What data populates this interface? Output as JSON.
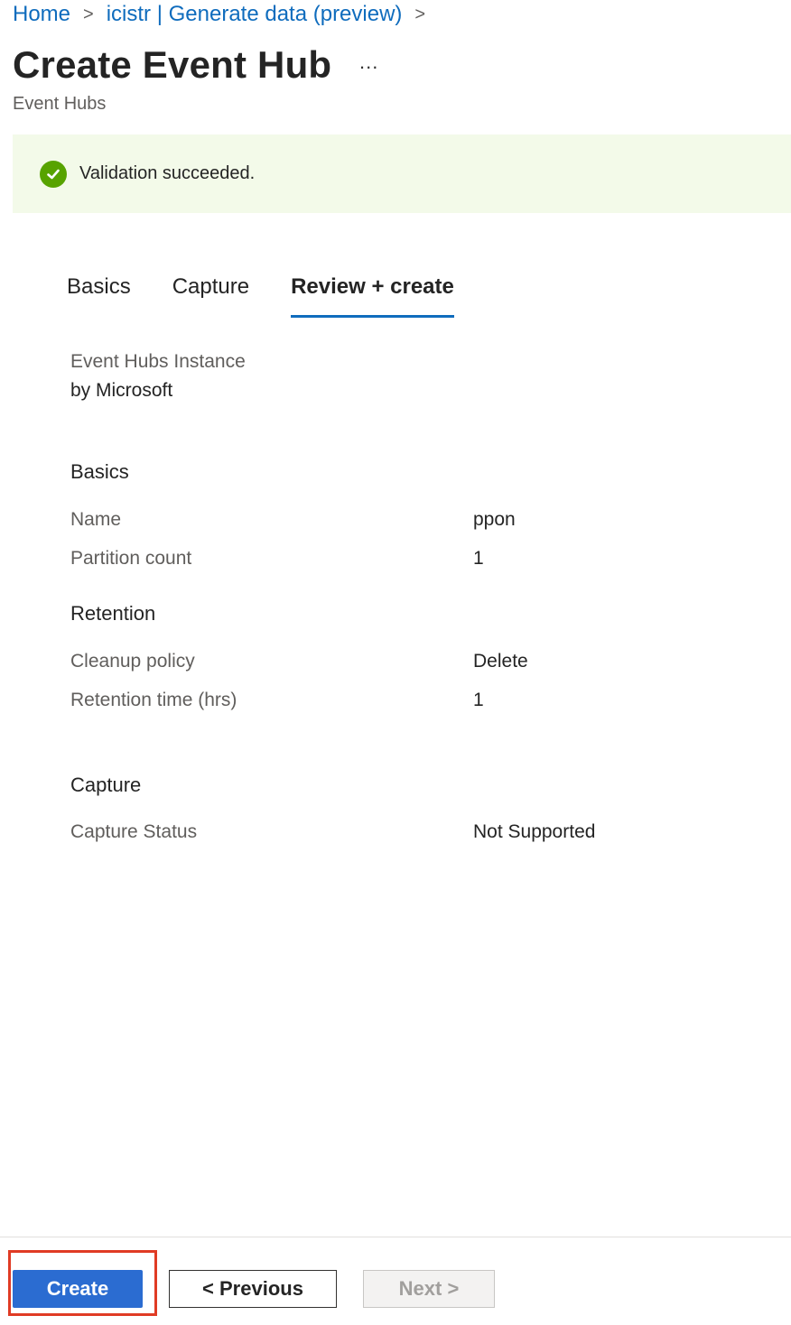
{
  "breadcrumb": {
    "home": "Home",
    "item": "icistr | Generate data (preview)",
    "separator": ">"
  },
  "header": {
    "title": "Create Event Hub",
    "more": "...",
    "subtitle": "Event Hubs"
  },
  "banner": {
    "message": "Validation succeeded.",
    "color": "#57a300"
  },
  "tabs": [
    {
      "label": "Basics"
    },
    {
      "label": "Capture"
    },
    {
      "label": "Review + create",
      "active": true
    }
  ],
  "product": {
    "name": "Event Hubs Instance",
    "publisher": "by Microsoft"
  },
  "sections": {
    "basics": {
      "title": "Basics",
      "rows": [
        {
          "label": "Name",
          "value": "ppon"
        },
        {
          "label": "Partition count",
          "value": "1"
        }
      ]
    },
    "retention": {
      "title": "Retention",
      "rows": [
        {
          "label": "Cleanup policy",
          "value": "Delete"
        },
        {
          "label": "Retention time (hrs)",
          "value": "1"
        }
      ]
    },
    "capture": {
      "title": "Capture",
      "rows": [
        {
          "label": "Capture Status",
          "value": "Not Supported"
        }
      ]
    }
  },
  "footer": {
    "create": "Create",
    "previous": "< Previous",
    "next": "Next >"
  },
  "colors": {
    "accent": "#0f6cbd",
    "primary_button": "#2b6cd1",
    "highlight": "#e03b24"
  }
}
